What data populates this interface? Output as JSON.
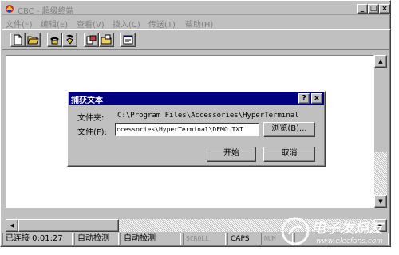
{
  "window": {
    "title": "CBC - 超级终端",
    "controls": {
      "minimize": "_",
      "maximize": "□",
      "close": "×"
    }
  },
  "menu": [
    "文件(F)",
    "编辑(E)",
    "查看(V)",
    "拨入(C)",
    "传送(T)",
    "帮助(H)"
  ],
  "toolbar": {
    "buttons": [
      {
        "name": "new",
        "icon": "new-document-icon"
      },
      {
        "name": "open",
        "icon": "open-folder-icon"
      },
      {
        "name": "connect",
        "icon": "phone-connect-icon"
      },
      {
        "name": "disconnect",
        "icon": "phone-disconnect-icon"
      },
      {
        "name": "send",
        "icon": "send-file-icon"
      },
      {
        "name": "receive",
        "icon": "receive-file-icon"
      },
      {
        "name": "properties",
        "icon": "properties-icon"
      }
    ]
  },
  "dialog": {
    "title": "捕获文本",
    "help": "?",
    "close": "×",
    "folder_label": "文件夹:",
    "folder_value": "C:\\Program Files\\Accessories\\HyperTerminal",
    "file_label": "文件(F):",
    "file_value": "ccessories\\HyperTerminal\\DEMO.TXT",
    "browse_button": "浏览(B)...",
    "start_button": "开始",
    "cancel_button": "取消"
  },
  "statusbar": {
    "connection": "已连接 0:01:27",
    "detect1": "自动检测",
    "detect2": "自动检测",
    "scroll": "SCROLL",
    "caps": "CAPS",
    "num": "NUM"
  },
  "watermark": {
    "text": "电子发烧友",
    "url": "www.elecfans.com"
  },
  "colors": {
    "face": "#c0c0c0",
    "dialog_title": "#000080",
    "terminal_bg": "#ffffff"
  }
}
